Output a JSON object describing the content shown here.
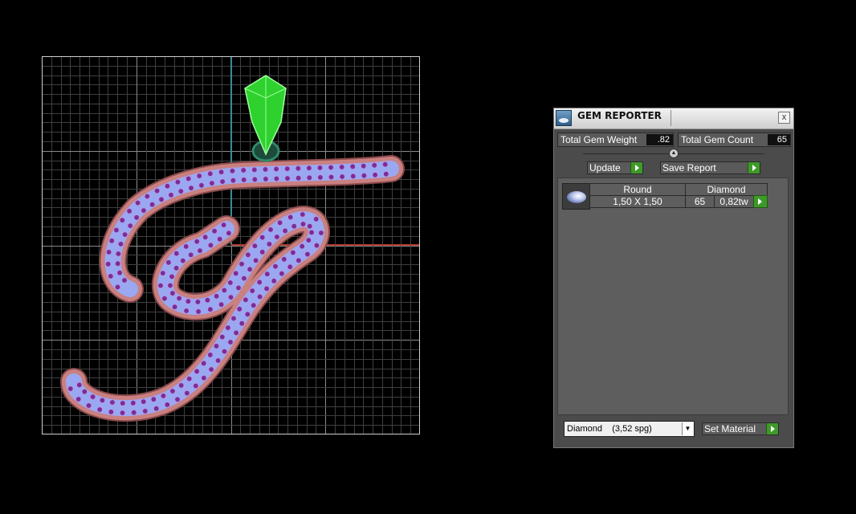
{
  "panel": {
    "title": "GEM REPORTER",
    "close_glyph": "x",
    "total_weight_label": "Total Gem Weight",
    "total_weight_value": ".82",
    "total_count_label": "Total Gem Count",
    "total_count_value": "65",
    "update_label": "Update",
    "save_report_label": "Save Report",
    "table": {
      "headers": {
        "shape": "Round",
        "material": "Diamond"
      },
      "rows": [
        {
          "size": "1,50 X 1,50",
          "count": "65",
          "weight": "0,82tw",
          "thumb_icon": "round-gem-icon"
        }
      ]
    },
    "material_select": {
      "value": "Diamond    (3,52 spg)"
    },
    "set_material_label": "Set Material"
  },
  "colors": {
    "grid_line": "#3f3f3f",
    "grid_major": "#8a8a8a",
    "x_axis": "#b03a2e",
    "y_axis": "#3a8a96",
    "metal": "#c98080",
    "pave_surface": "#9aa8f2",
    "gem": "#7b2d96",
    "bail": "#3ad43a",
    "play_button": "#3e9a28"
  }
}
